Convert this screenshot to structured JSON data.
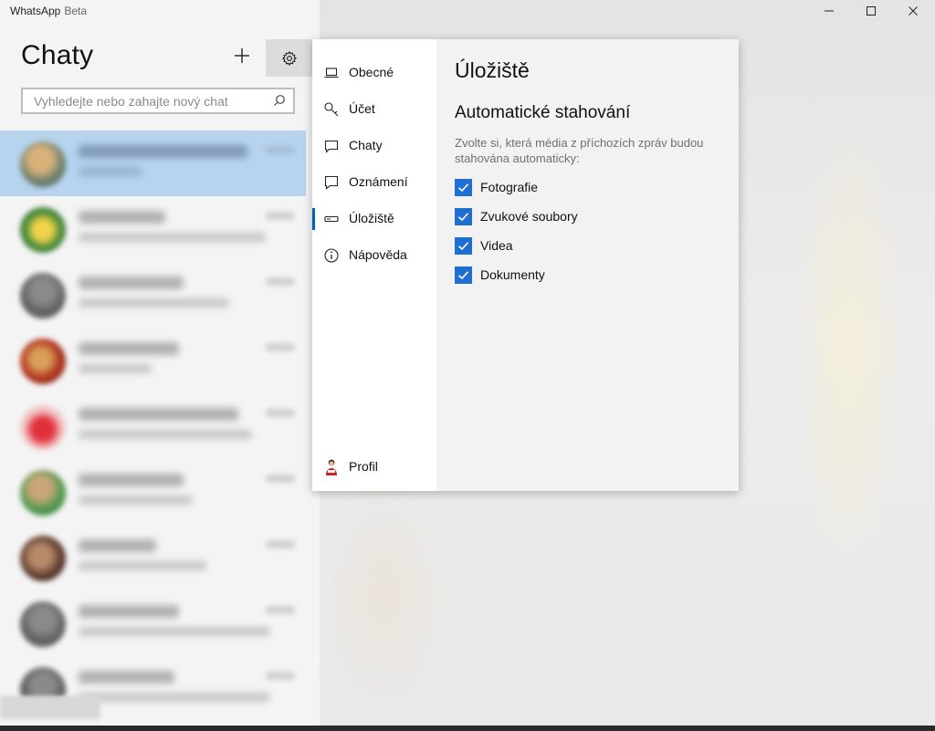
{
  "window": {
    "app_name": "WhatsApp",
    "app_badge": "Beta"
  },
  "sidebar": {
    "title": "Chaty",
    "search_placeholder": "Vyhledejte nebo zahajte nový chat"
  },
  "settings": {
    "nav_items": [
      {
        "label": "Obecné",
        "icon": "laptop-icon"
      },
      {
        "label": "Účet",
        "icon": "key-icon"
      },
      {
        "label": "Chaty",
        "icon": "chat-bubble-icon"
      },
      {
        "label": "Oznámení",
        "icon": "notification-icon"
      },
      {
        "label": "Úložiště",
        "icon": "storage-icon",
        "active": true
      },
      {
        "label": "Nápověda",
        "icon": "info-icon"
      }
    ],
    "profile_label": "Profil",
    "storage": {
      "title": "Úložiště",
      "section_title": "Automatické stahování",
      "description": "Zvolte si, která média z příchozích zpráv budou stahována automaticky:",
      "options": [
        {
          "label": "Fotografie",
          "checked": true
        },
        {
          "label": "Zvukové soubory",
          "checked": true
        },
        {
          "label": "Videa",
          "checked": true
        },
        {
          "label": "Dokumenty",
          "checked": true
        }
      ]
    }
  },
  "colors": {
    "accent": "#1e6fd1",
    "selected_chat": "#b7d3ee",
    "nav_marker": "#0063b1"
  }
}
